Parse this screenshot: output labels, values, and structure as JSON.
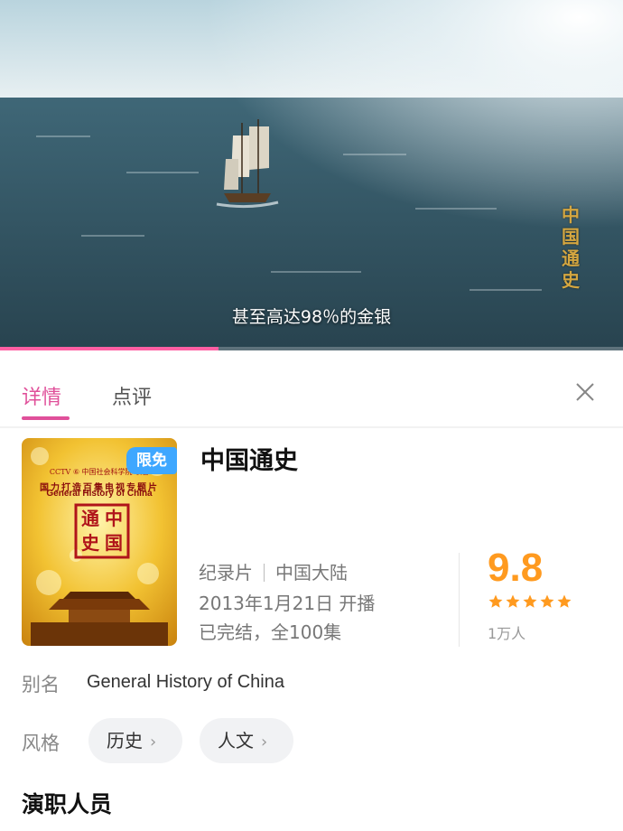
{
  "player": {
    "subtitle": "甚至高达98％的金银",
    "watermark": [
      "中",
      "国",
      "通",
      "史"
    ],
    "progress_fraction": 0.35
  },
  "tabs": [
    {
      "label": "详情",
      "active": true
    },
    {
      "label": "点评",
      "active": false
    }
  ],
  "poster": {
    "line1": "CCTV ⑥ 中国社会科学院 联合",
    "line2": "国力打造百集电视专题片",
    "line3": "General History of China",
    "seal": [
      "中",
      "国",
      "通",
      "史"
    ],
    "badge": "限免"
  },
  "show": {
    "title": "中国通史",
    "genre_type": "纪录片",
    "region": "中国大陆",
    "premiere": "2013年1月21日 开播",
    "status": "已完结，全100集"
  },
  "rating": {
    "score": "9.8",
    "stars": 5,
    "votes": "1万人",
    "color": "#ff9a1f"
  },
  "alias": {
    "label": "别名",
    "value": "General History of China"
  },
  "genre": {
    "label": "风格",
    "tags": [
      "历史",
      "人文"
    ]
  },
  "cast": {
    "title": "演职人员"
  },
  "colors": {
    "accent": "#e0509a",
    "badge": "#3ea7ff",
    "progress": "#ff5fa3"
  }
}
